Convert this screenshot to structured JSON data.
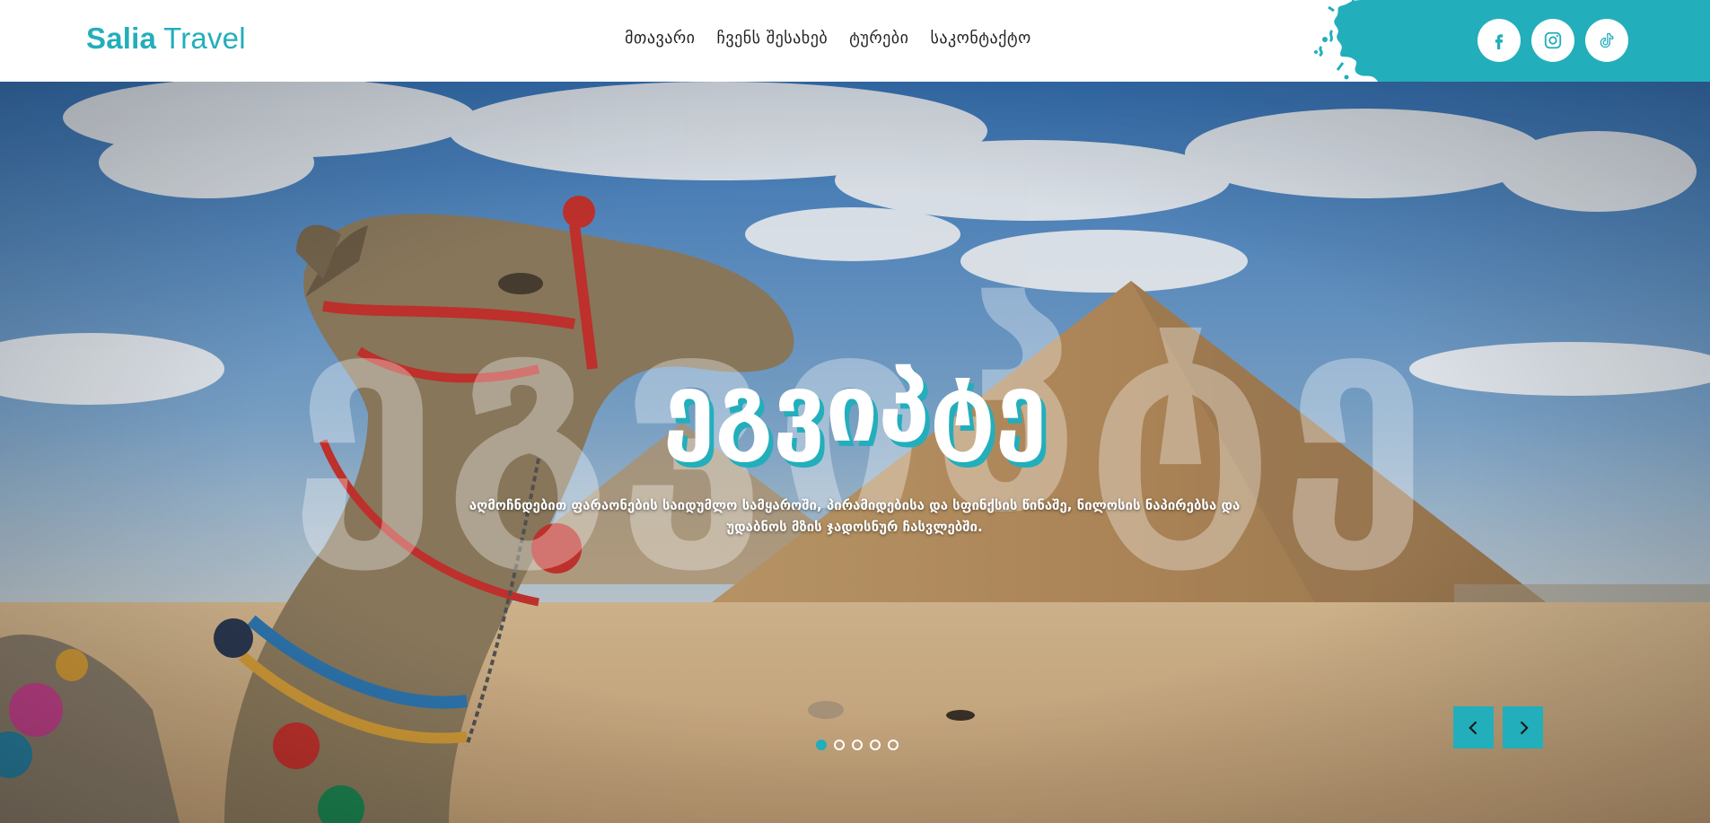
{
  "logo": {
    "part1": "Salia",
    "part2": "Travel"
  },
  "nav": {
    "items": [
      {
        "label": "მთავარი"
      },
      {
        "label": "ჩვენს შესახებ"
      },
      {
        "label": "ტურები"
      },
      {
        "label": "საკონტაქტო"
      }
    ]
  },
  "social": [
    {
      "icon": "facebook-icon"
    },
    {
      "icon": "instagram-icon"
    },
    {
      "icon": "tiktok-icon"
    }
  ],
  "hero": {
    "ghost_text": "ეგვიპტე",
    "title": "ეგვიპტე",
    "subtitle": "აღმოჩნდებით ფარაონების საიდუმლო სამყაროში, პირამიდებისა და სფინქსის წინაშე, ნილოსის ნაპირებსა და უდაბნოს მზის ჯადოსნურ ჩასვლებში.",
    "slides_count": 5,
    "active_slide": 1
  },
  "colors": {
    "accent": "#23aebb",
    "text": "#222222"
  }
}
